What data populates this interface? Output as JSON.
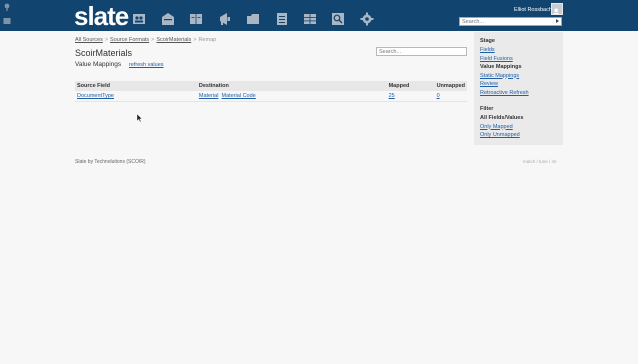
{
  "header": {
    "logo": "slate",
    "user_name": "Elliot Rossbach",
    "search_placeholder": "Search...",
    "nav_icons": [
      "people-icon",
      "inbox-icon",
      "book-icon",
      "megaphone-icon",
      "folder-icon",
      "list-icon",
      "grid-icon",
      "query-icon",
      "gear-icon"
    ]
  },
  "breadcrumb": {
    "items": [
      "All Sources",
      "Source Formats",
      "ScoirMaterials"
    ],
    "current": "Remap"
  },
  "page": {
    "title": "ScoirMaterials",
    "subtitle": "Value Mappings",
    "refresh_link": "refresh values",
    "search_placeholder": "Search..."
  },
  "table": {
    "headers": [
      "Source Field",
      "Destination",
      "Mapped",
      "Unmapped"
    ],
    "rows": [
      {
        "source": "DocumentType",
        "dest_a": "Material",
        "dest_b": "Material Code",
        "mapped": "25",
        "unmapped": "0"
      }
    ]
  },
  "sidebar": {
    "stage_heading": "Stage",
    "stage_items": [
      {
        "label": "Fields",
        "active": false
      },
      {
        "label": "Field Fusions",
        "active": false
      },
      {
        "label": "Value Mappings",
        "active": true
      },
      {
        "label": "Static Mappings",
        "active": false
      },
      {
        "label": "Review",
        "active": false
      },
      {
        "label": "Retroactive Refresh",
        "active": false
      }
    ],
    "filter_heading": "Filter",
    "filter_items": [
      {
        "label": "All Fields/Values",
        "active": true
      },
      {
        "label": "Only Mapped",
        "active": false
      },
      {
        "label": "Only Unmapped",
        "active": false
      }
    ]
  },
  "footer": {
    "left": "Slate by Technolutions (SCOIR)",
    "right": "match / tune / 4n"
  },
  "colors": {
    "topbar": "#11446e",
    "link": "#1f5fa8",
    "sidebar_bg": "#eaeaea",
    "table_header_bg": "#e7e7e7"
  }
}
